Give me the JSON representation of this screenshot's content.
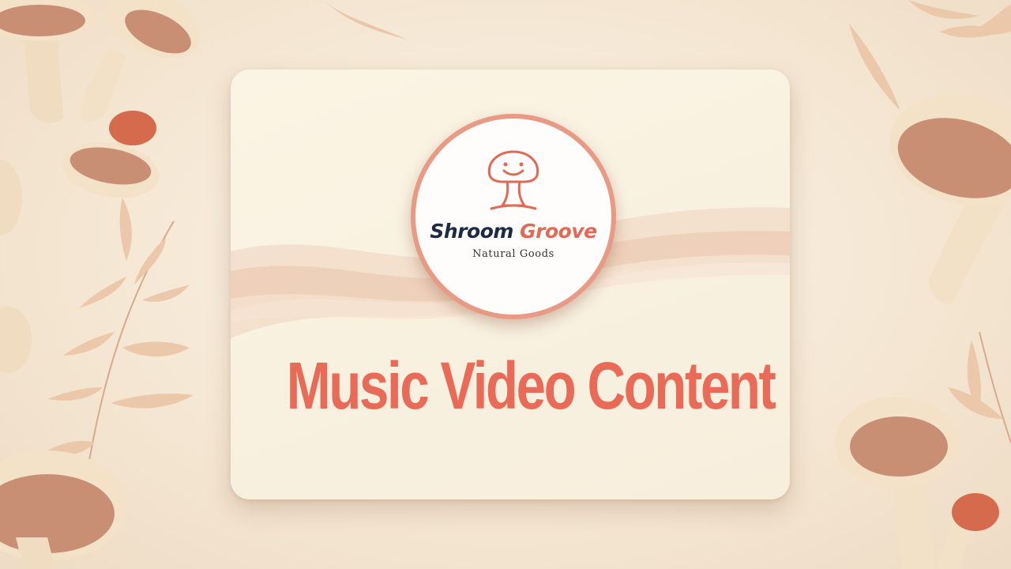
{
  "brand": {
    "name_part1": "Shroom",
    "name_part2": "Groove",
    "tagline": "Natural Goods"
  },
  "headline": "Music Video Content",
  "colors": {
    "accent": "#ea6a58",
    "brand_dark": "#1d2a44",
    "background": "#f6ead9",
    "card": "#fbf4e4"
  },
  "icons": [
    "smiling-mushroom-icon"
  ]
}
